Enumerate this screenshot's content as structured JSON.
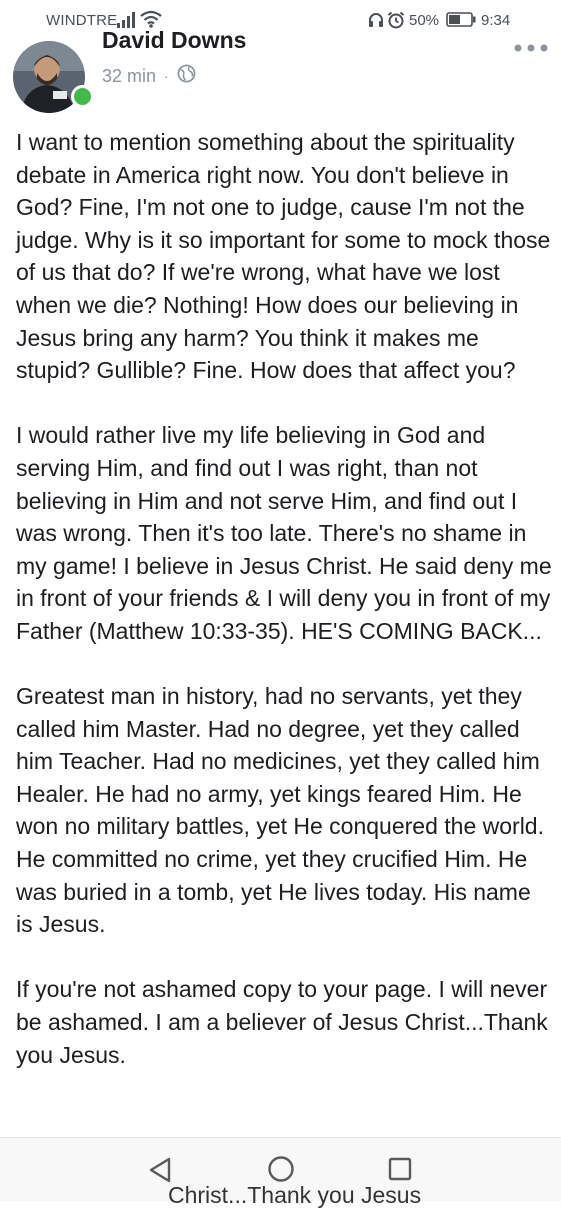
{
  "status_bar": {
    "carrier": "WINDTRE",
    "battery": "50%",
    "time": "9:34",
    "icons": [
      "signal-icon",
      "wifi-icon",
      "headset-icon",
      "alarm-icon",
      "battery-icon"
    ]
  },
  "post": {
    "author": "David Downs",
    "time": "32 min",
    "separator": "·",
    "privacy_icon": "globe-icon",
    "paragraphs": [
      "I want to mention something about the spirituality debate in America right now. You don't believe in God? Fine, I'm not one to judge, cause I'm not the judge. Why is it so important for some to mock those of us that do? If we're wrong, what have we lost when we die? Nothing! How does our believing in Jesus bring any harm? You think it makes me stupid? Gullible? Fine. How does that affect you?",
      "I would rather live my life believing in God and serving Him, and find out I was right, than not believing in Him and not serve Him, and find out I was wrong. Then it's too late. There's no shame in my game! I believe in Jesus Christ. He said deny me in front of your friends & I will deny you in front of my Father (Matthew 10:33-35). HE'S COMING BACK...",
      "Greatest man in history, had no servants, yet they called him Master. Had no degree, yet they called him Teacher. Had no medicines, yet they called him Healer. He had no army, yet kings feared Him. He won no military battles, yet He conquered the world. He committed no crime, yet they crucified Him. He was buried in a tomb, yet He lives today. His name is Jesus.",
      "If you're not ashamed copy to your page. I will never be ashamed. I am a believer of Jesus Christ...Thank you Jesus."
    ],
    "ghost_text": "Christ...Thank you Jesus"
  },
  "colors": {
    "online": "#44b84a",
    "text": "#1c1e21",
    "meta": "#8d949e"
  }
}
